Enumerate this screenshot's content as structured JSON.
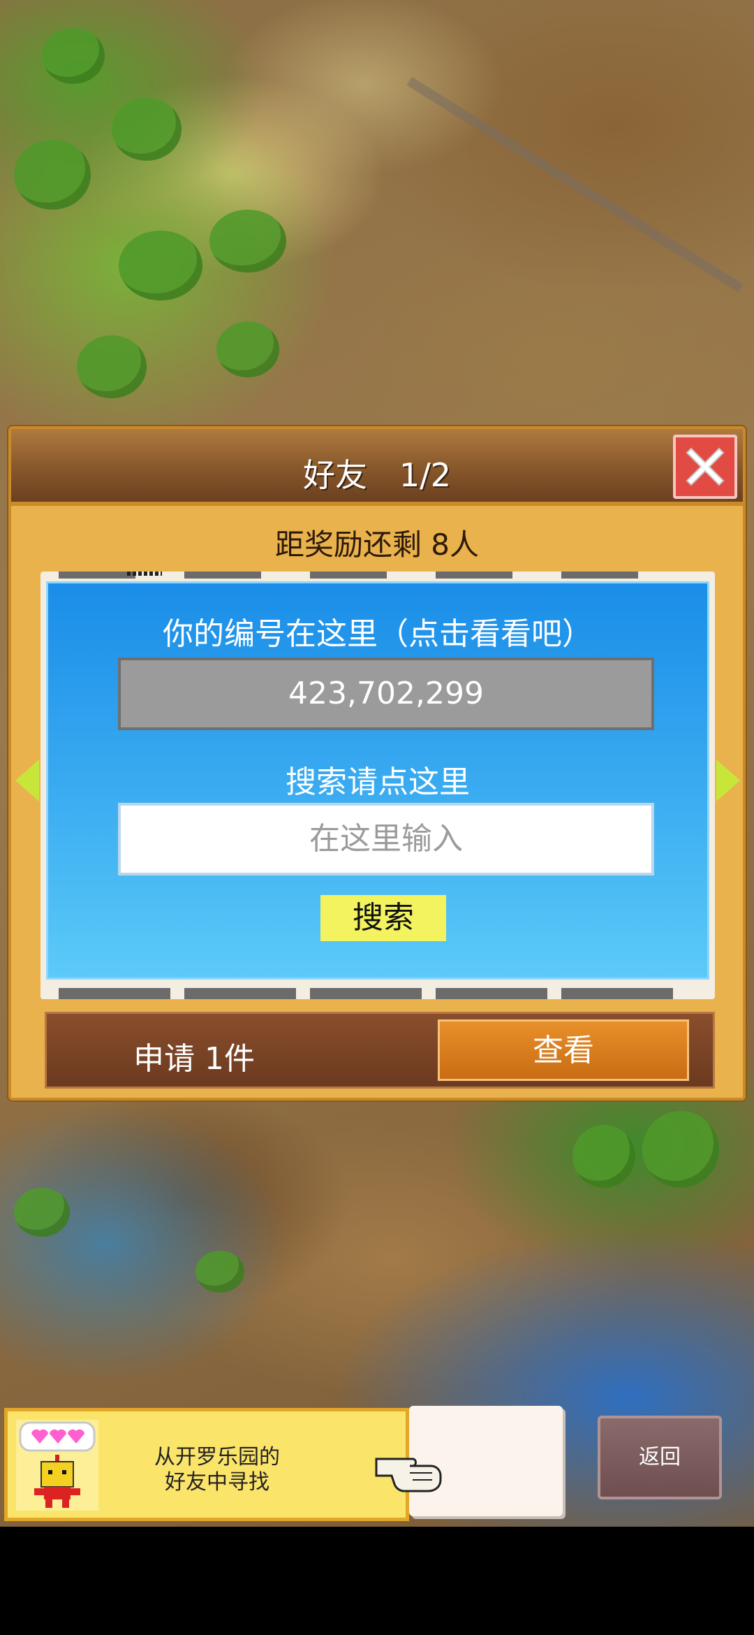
{
  "dialog": {
    "title": "好友　1/2",
    "reward_text": "距奖励还剩 8人",
    "id_label": "你的编号在这里（点击看看吧）",
    "player_id": "423,702,299",
    "search_label": "搜索请点这里",
    "search_placeholder": "在这里输入",
    "search_button": "搜索",
    "request_text": "申请 1件",
    "view_button": "查看"
  },
  "bottom": {
    "banner_line1": "从开罗乐园的",
    "banner_line2": "好友中寻找",
    "back_button": "返回"
  },
  "colors": {
    "dialog_bg": "#e9b24d",
    "panel_blue": "#1a8de8",
    "close_red": "#e24b43",
    "search_button": "#f2f35f",
    "view_button": "#e8902a",
    "nav_arrow": "#c8e63a"
  },
  "icons": [
    "close-icon",
    "prev-arrow-icon",
    "next-arrow-icon",
    "hearts-icon",
    "kairobot-icon",
    "pointing-hand-icon"
  ]
}
